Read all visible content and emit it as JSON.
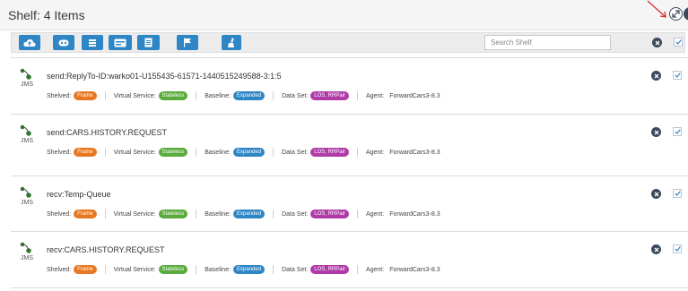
{
  "header": {
    "title": "Shelf: 4 Items"
  },
  "toolbar": {
    "buttons": [
      {
        "icon": "cloud-upload-icon"
      },
      {
        "icon": "tag-icon"
      },
      {
        "icon": "list-icon"
      },
      {
        "icon": "card-icon"
      },
      {
        "icon": "document-icon"
      },
      {
        "icon": "flag-icon"
      },
      {
        "icon": "brush-icon"
      }
    ],
    "search_placeholder": "Search Shelf"
  },
  "labels": {
    "shelved": "Shelved:",
    "virtual_service": "Virtual Service:",
    "baseline": "Baseline:",
    "data_set": "Data Set:",
    "agent": "Agent:"
  },
  "colors": {
    "frame": "#e87722",
    "stateless": "#5aab3c",
    "expanded": "#2f86c4",
    "dataset": "#b03aa8",
    "button": "#2f86c4",
    "icon_dark": "#3a4a5c"
  },
  "items": [
    {
      "protocol": "JMS",
      "operation": "send:ReplyTo-ID:warko01-U155435-61571-1440515249588-3:1:5",
      "shelved": "Frame",
      "virtual_service": "Stateless",
      "baseline": "Expanded",
      "data_set_a": "LOS",
      "data_set_b": "RRPair",
      "agent": "ForwardCars3-8.3",
      "checked": true
    },
    {
      "protocol": "JMS",
      "operation": "send:CARS.HISTORY.REQUEST",
      "shelved": "Frame",
      "virtual_service": "Stateless",
      "baseline": "Expanded",
      "data_set_a": "LOS",
      "data_set_b": "RRPair",
      "agent": "ForwardCars3-8.3",
      "checked": true
    },
    {
      "protocol": "JMS",
      "operation": "recv:Temp-Queue",
      "shelved": "Frame",
      "virtual_service": "Stateless",
      "baseline": "Expanded",
      "data_set_a": "LOS",
      "data_set_b": "RRPair",
      "agent": "ForwardCars3-8.3",
      "checked": true
    },
    {
      "protocol": "JMS",
      "operation": "recv:CARS.HISTORY.REQUEST",
      "shelved": "Frame",
      "virtual_service": "Stateless",
      "baseline": "Expanded",
      "data_set_a": "LOS",
      "data_set_b": "RRPair",
      "agent": "ForwardCars3-8.3",
      "checked": true
    }
  ]
}
